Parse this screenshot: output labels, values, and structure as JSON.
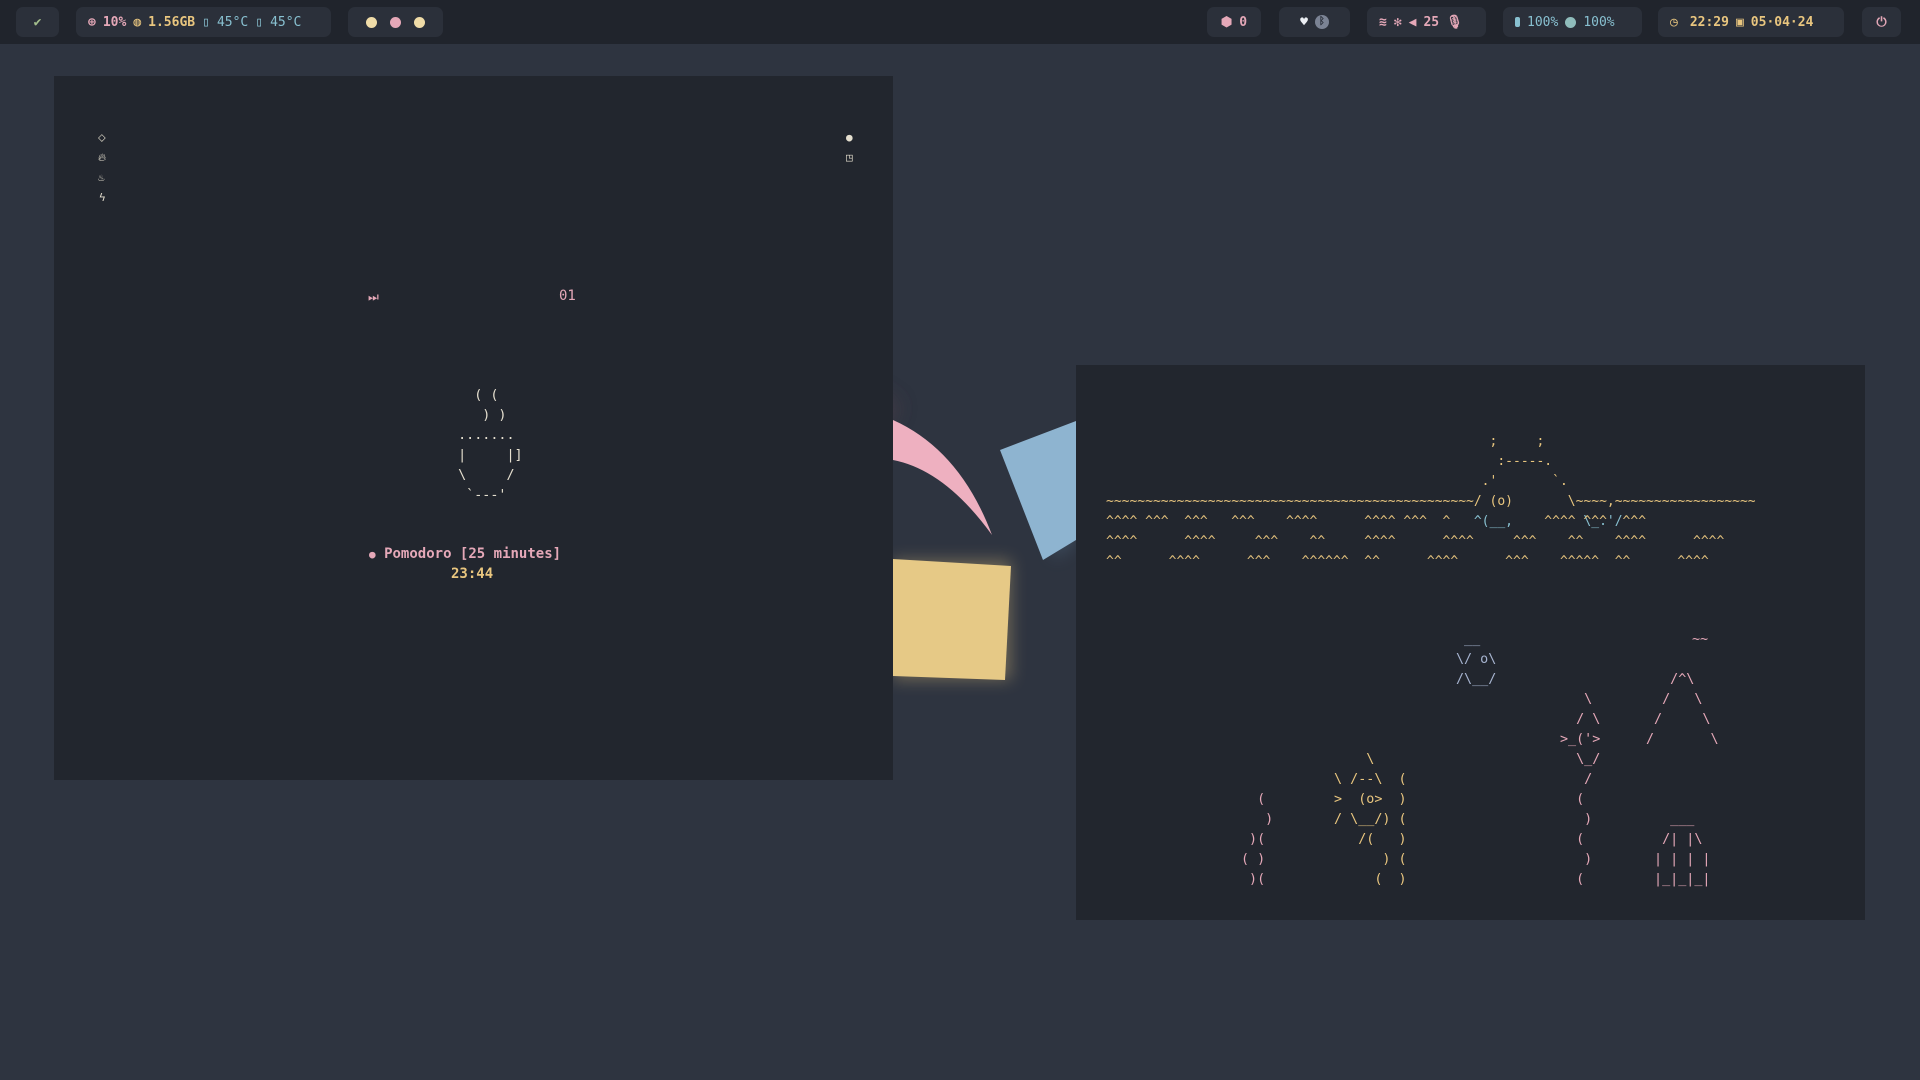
{
  "colors": {
    "background": "#2e3440",
    "bar": "#20242c",
    "module": "#2b303a",
    "window": "#22262e",
    "pink": "#e5a8b8",
    "yellow": "#e9c67f",
    "blue": "#88c0d0",
    "teal": "#8fbcbb",
    "red": "#bf616a",
    "gray": "#d8dee9"
  },
  "topbar": {
    "launcher_icon": "check-feather-icon",
    "system": {
      "cpu_icon": "cpu-icon",
      "cpu": "10%",
      "mem_icon": "memory-icon",
      "mem": "1.56GB",
      "temp1_icon": "thermometer-icon",
      "temp1": "45°C",
      "temp2_icon": "thermometer-icon",
      "temp2": "45°C"
    },
    "workspaces": [
      "#e9c67f",
      "#e5a8b8",
      "#e9c67f"
    ],
    "updates": {
      "icon": "package-icon",
      "count": "0"
    },
    "tray": {
      "icon": "heart-icon",
      "badge_icon": "bluetooth-badge-icon"
    },
    "network": {
      "wifi_icon": "wifi-icon",
      "bluetooth_icon": "bluetooth-off-icon",
      "volume_icon": "volume-icon",
      "volume": "25",
      "mic_icon": "microphone-icon"
    },
    "battery": {
      "icon": "battery-icon",
      "value1": "100%",
      "icon2": "circle-icon",
      "value2": "100%"
    },
    "clock": {
      "clock_icon": "clock-icon",
      "time": "22:29",
      "calendar_icon": "calendar-icon",
      "date": "05·04·24"
    },
    "power_icon": "power-icon"
  },
  "left_window": {
    "side_icons_left": [
      "chevron-up-down-icon",
      "flame-icon",
      "hot-cup-icon",
      "lightning-icon"
    ],
    "side_icons_right": [
      "circle-info-icon",
      "clipboard-icon"
    ],
    "skip_icon": "skip-forward-icon",
    "counter": "01",
    "coffee_art": "    ( (\n     ) )\n  .......\n  |     |]\n  \\     /\n   `---'",
    "pomodoro_icon": "tomato-icon",
    "pomodoro_label": "Pomodoro [25 minutes]",
    "timer": "23:44"
  },
  "right_window": {
    "island_top": "                                                 ;     ;\n                                                  :-----.\n                                                .'       `.",
    "island_sea": "~~~~~~~~~~~~~~~~~~~~~~~~~~~~~~~~~~~~~~~~~~~~~~~/ (o)       \\~~~~,~~~~~~~~~~~~~~~~~~",
    "island_rock": "                                               ^(__,         \\_.'/",
    "waves": "^^^^ ^^^  ^^^   ^^^    ^^^^      ^^^^ ^^^  ^            ^^^^ ^^^  ^^^\n^^^^      ^^^^     ^^^    ^^     ^^^^      ^^^^     ^^^    ^^    ^^^^      ^^^^\n^^      ^^^^      ^^^    ^^^^^^  ^^      ^^^^      ^^^    ^^^^^  ^^      ^^^^",
    "wiggle": "~~",
    "bird_small": " __\n\\/ o\\\n/\\__/",
    "bird_flamingo": "   \\\n  / \\\n>_('>\n  \\_/\n   /\n  (\n   )\n  (\n   )\n  (",
    "tent": "   /^\\\n  /   \\\n /     \\\n/       \\",
    "smoke": "  (\n   )\n )(\n( )\n )(",
    "bird_big": "     \\\n \\ /--\\  (\n >  (o>  )\n / \\__/) (\n    /(   )\n       ) (\n      (  )",
    "hut": "   ___\n  /| |\\\n | | | |\n |_|_|_|"
  }
}
